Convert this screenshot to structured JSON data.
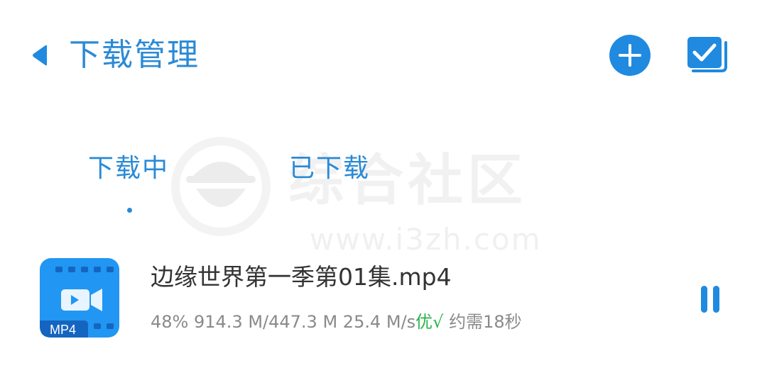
{
  "header": {
    "title": "下载管理",
    "back_icon": "back-arrow-icon",
    "add_icon": "plus-circle-icon",
    "select_icon": "checkbox-multi-icon"
  },
  "tabs": [
    {
      "label": "下载中",
      "active": true
    },
    {
      "label": "已下载",
      "active": false
    }
  ],
  "watermark": {
    "name": "综合社区",
    "url": "www.i3zh.com"
  },
  "downloads": [
    {
      "file_name": "边缘世界第一季第01集.mp4",
      "file_type": "MP4",
      "progress": "48%",
      "progress_fraction": 0.48,
      "downloaded_size": "914.3 M",
      "total_size": "447.3 M",
      "size_text": "914.3 M/447.3 M",
      "speed": "25.4 M/s",
      "quality": "优",
      "quality_mark": "√",
      "remaining": "约需18秒"
    }
  ],
  "colors": {
    "accent": "#1f8ae0",
    "text_accent": "#2a8ad6",
    "quality_green": "#2bb24c",
    "muted_text": "#8a8a8a",
    "icon_blue": "#2196f3"
  }
}
